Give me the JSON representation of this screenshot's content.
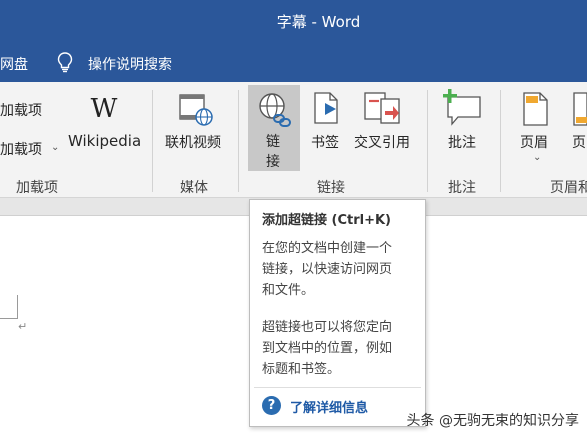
{
  "window": {
    "title": "字幕  -  Word"
  },
  "menubar": {
    "items": [
      {
        "label": "网盘"
      },
      {
        "label": "操作说明搜索"
      }
    ]
  },
  "ribbon": {
    "addins": {
      "item1": "加载项",
      "item2": "加载项",
      "wikipedia": "Wikipedia",
      "group": "加载项"
    },
    "media": {
      "online_video": "联机视频",
      "group": "媒体"
    },
    "links": {
      "link_line1": "链",
      "link_line2": "接",
      "bookmark": "书签",
      "cross_reference": "交叉引用",
      "group": "链接"
    },
    "comments": {
      "comment": "批注",
      "group": "批注"
    },
    "header_footer": {
      "header": "页眉",
      "footer_partial": "页",
      "group": "页眉和"
    }
  },
  "tooltip": {
    "title": "添加超链接 (Ctrl+K)",
    "para1": [
      "在您的文档中创建一个",
      "链接，以快速访问网页",
      "和文件。"
    ],
    "para2": [
      "超链接也可以将您定向",
      "到文档中的位置，例如",
      "标题和书签。"
    ],
    "learn_more": "了解详细信息"
  },
  "document": {
    "paragraph_mark": "↵"
  },
  "watermark": "头条 @无驹无束的知识分享",
  "colors": {
    "title_bar": "#2b579a",
    "ribbon": "#f3f3f3",
    "accent_green": "#4caf50",
    "link_blue": "#1f5aa6"
  }
}
